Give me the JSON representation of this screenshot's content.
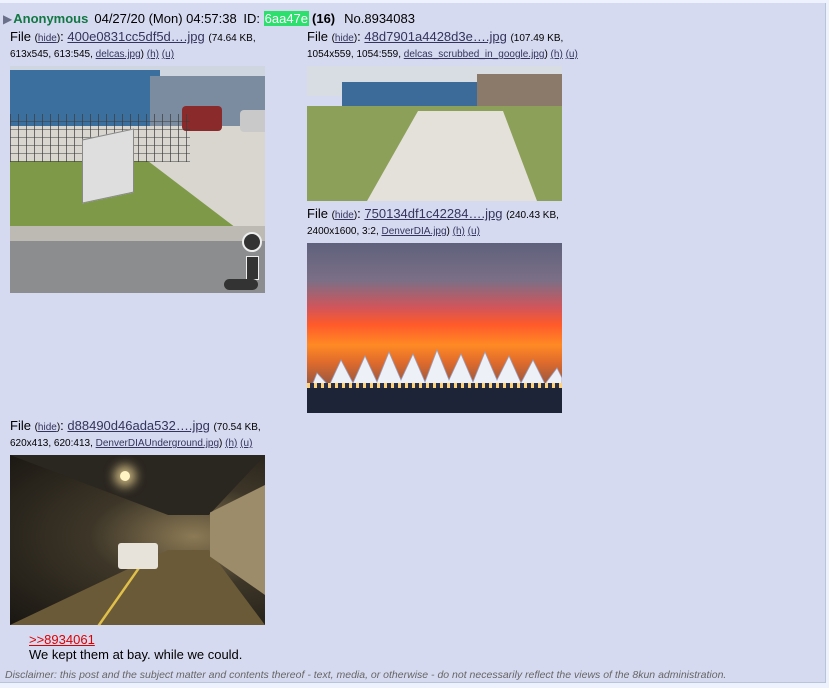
{
  "intro": {
    "arrow": "▶",
    "name": "Anonymous",
    "date": "04/27/20 (Mon) 04:57:38",
    "id_label": "ID:",
    "poster_id": "6aa47e",
    "post_count": "(16)",
    "post_no": "No.8934083"
  },
  "files": [
    {
      "label": "File",
      "hide": "hide",
      "filename": "400e0831cc5df5d….jpg",
      "size": "(74.64 KB,",
      "dims": "613x545, 613:545,",
      "orig": "delcas.jpg",
      "h": "(h)",
      "u": "(u)"
    },
    {
      "label": "File",
      "hide": "hide",
      "filename": "48d7901a4428d3e….jpg",
      "size": "(107.49 KB,",
      "dims": "1054x559, 1054:559,",
      "orig": "delcas_scrubbed_in_google.jpg",
      "h": "(h)",
      "u": "(u)"
    },
    {
      "label": "File",
      "hide": "hide",
      "filename": "750134df1c42284….jpg",
      "size": "(240.43 KB,",
      "dims": "2400x1600, 3:2,",
      "orig": "DenverDIA.jpg",
      "h": "(h)",
      "u": "(u)"
    },
    {
      "label": "File",
      "hide": "hide",
      "filename": "d88490d46ada532….jpg",
      "size": "(70.54 KB,",
      "dims": "620x413, 620:413,",
      "orig": "DenverDIAUnderground.jpg",
      "h": "(h)",
      "u": "(u)"
    }
  ],
  "body": {
    "quote": ">>8934061",
    "message": "We kept them at bay. while we could."
  },
  "disclaimer": "Disclaimer: this post and the subject matter and contents thereof - text, media, or otherwise - do not necessarily reflect the views of the 8kun administration.",
  "colors": {
    "post_bg": "#d6daf0",
    "name": "#117743",
    "id_bg": "#2de06e",
    "link": "#34345c",
    "quote": "#dd0000"
  }
}
